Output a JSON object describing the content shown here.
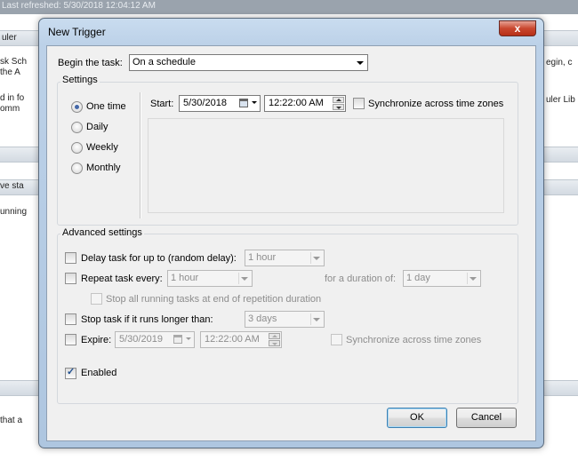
{
  "background": {
    "top_bar_text": "Last refreshed: 5/30/2018 12:04:12 AM",
    "fragments": {
      "uler": "uler",
      "sk_sch": "sk Sch",
      "the_a": "the A",
      "d_in_fo": "d in fo",
      "omm": "omm",
      "ve_sta": "ve sta",
      "unning": "unning",
      "that_a": "that a",
      "egin_c": "egin, c",
      "uler_lib": "uler Lib"
    }
  },
  "dialog": {
    "title": "New Trigger",
    "close_glyph": "x",
    "begin_label": "Begin the task:",
    "begin_value": "On a schedule",
    "settings": {
      "title": "Settings",
      "radios": [
        "One time",
        "Daily",
        "Weekly",
        "Monthly"
      ],
      "selected": "One time",
      "start_label": "Start:",
      "start_date": "5/30/2018",
      "start_time": "12:22:00 AM",
      "sync_label": "Synchronize across time zones",
      "sync_checked": false
    },
    "advanced": {
      "title": "Advanced settings",
      "delay_label": "Delay task for up to (random delay):",
      "delay_value": "1 hour",
      "repeat_label": "Repeat task every:",
      "repeat_value": "1 hour",
      "duration_label": "for a duration of:",
      "duration_value": "1 day",
      "stop_all_label": "Stop all running tasks at end of repetition duration",
      "stop_longer_label": "Stop task if it runs longer than:",
      "stop_longer_value": "3 days",
      "expire_label": "Expire:",
      "expire_date": "5/30/2019",
      "expire_time": "12:22:00 AM",
      "expire_sync_label": "Synchronize across time zones",
      "enabled_label": "Enabled",
      "enabled_checked": true
    },
    "buttons": {
      "ok": "OK",
      "cancel": "Cancel"
    }
  },
  "colors": {
    "title_bar": "#bcd1e8",
    "close_button": "#c9472f",
    "client_bg": "#f0f0f0",
    "radio_dot": "#4468a8"
  }
}
